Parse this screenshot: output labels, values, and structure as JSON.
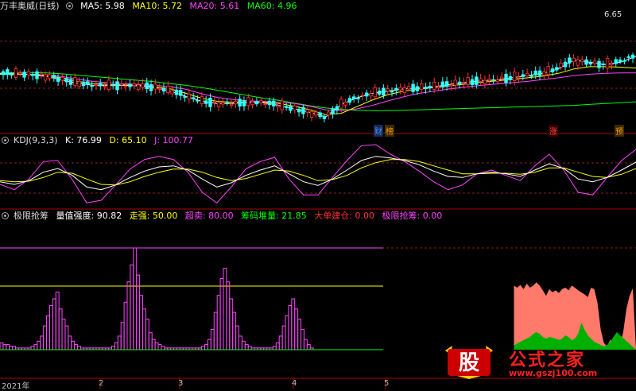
{
  "main": {
    "title": "万丰奥威(日线)",
    "ma": [
      {
        "label": "MA5: 5.98",
        "color": "#ffffff"
      },
      {
        "label": "MA10: 5.72",
        "color": "#ffff00"
      },
      {
        "label": "MA20: 5.61",
        "color": "#ff44ff"
      },
      {
        "label": "MA60: 4.96",
        "color": "#00ff00"
      }
    ],
    "high_label": "6.65",
    "markers": [
      {
        "text": "财",
        "color": "#4a90ff"
      },
      {
        "text": "榜",
        "color": "#ff9900"
      },
      {
        "text": "涨",
        "color": "#ff4444"
      },
      {
        "text": "预",
        "color": "#ff9900"
      }
    ]
  },
  "kdj": {
    "title": "KDJ(9,3,3)",
    "values": [
      {
        "label": "K: 76.99",
        "color": "#ffffff"
      },
      {
        "label": "D: 65.10",
        "color": "#ffff00"
      },
      {
        "label": "J: 100.77",
        "color": "#ff44ff"
      }
    ]
  },
  "ind": {
    "title": "极限抢筹",
    "values": [
      {
        "label": "量值强度: 90.82",
        "color": "#ffffff"
      },
      {
        "label": "走强: 50.00",
        "color": "#ffff00"
      },
      {
        "label": "超卖: 80.00",
        "color": "#ff44ff"
      },
      {
        "label": "筹码堆量: 21.85",
        "color": "#00ff00"
      },
      {
        "label": "大单建仓: 0.00",
        "color": "#ff3333"
      },
      {
        "label": "极限抢筹: 0.00",
        "color": "#ff44ff"
      }
    ]
  },
  "dates": [
    "2021年",
    "2",
    "3",
    "4",
    "5"
  ],
  "watermark": {
    "logo": "股",
    "name": "公式之家",
    "url": "www.gszj100.com"
  },
  "chart_data": [
    {
      "type": "candlestick",
      "panel": "main",
      "ylim": [
        4.3,
        7.0
      ],
      "ma": {
        "MA5": [
          5.6,
          5.6,
          5.57,
          5.53,
          5.45,
          5.38,
          5.33,
          5.33,
          5.33,
          5.32,
          5.28,
          5.2,
          5.08,
          4.97,
          4.92,
          4.92,
          4.95,
          4.94,
          4.88,
          4.8,
          4.72,
          4.62,
          4.9,
          5.05,
          5.15,
          5.2,
          5.25,
          5.27,
          5.3,
          5.35,
          5.4,
          5.43,
          5.45,
          5.5,
          5.55,
          5.6,
          5.7,
          5.9,
          5.85,
          5.8,
          5.85,
          5.98
        ],
        "MA10": [
          5.58,
          5.58,
          5.57,
          5.55,
          5.5,
          5.42,
          5.37,
          5.35,
          5.34,
          5.33,
          5.3,
          5.25,
          5.15,
          5.04,
          4.97,
          4.95,
          4.95,
          4.95,
          4.92,
          4.86,
          4.78,
          4.67,
          4.7,
          4.85,
          5.0,
          5.12,
          5.2,
          5.25,
          5.28,
          5.32,
          5.36,
          5.4,
          5.43,
          5.46,
          5.5,
          5.54,
          5.6,
          5.7,
          5.75,
          5.75,
          5.74,
          5.72
        ],
        "MA20": [
          5.58,
          5.58,
          5.58,
          5.57,
          5.53,
          5.47,
          5.42,
          5.39,
          5.37,
          5.35,
          5.33,
          5.3,
          5.24,
          5.14,
          5.06,
          5.01,
          4.98,
          4.97,
          4.95,
          4.92,
          4.86,
          4.78,
          4.76,
          4.8,
          4.88,
          4.98,
          5.07,
          5.15,
          5.2,
          5.25,
          5.29,
          5.33,
          5.36,
          5.39,
          5.42,
          5.46,
          5.5,
          5.55,
          5.58,
          5.6,
          5.61,
          5.61
        ],
        "MA60": [
          5.6,
          5.62,
          5.62,
          5.61,
          5.59,
          5.56,
          5.53,
          5.5,
          5.47,
          5.44,
          5.41,
          5.37,
          5.33,
          5.28,
          5.22,
          5.16,
          5.1,
          5.04,
          4.99,
          4.93,
          4.87,
          4.82,
          4.79,
          4.77,
          4.76,
          4.76,
          4.77,
          4.78,
          4.79,
          4.8,
          4.81,
          4.82,
          4.83,
          4.84,
          4.85,
          4.86,
          4.87,
          4.88,
          4.9,
          4.92,
          4.94,
          4.96
        ]
      },
      "series_colors": {
        "MA5": "#ffffff",
        "MA10": "#ffff00",
        "MA20": "#ff44ff",
        "MA60": "#00ff00"
      },
      "annotations": [
        "6.65"
      ]
    },
    {
      "type": "line",
      "panel": "kdj",
      "ylim": [
        -10,
        110
      ],
      "series": [
        {
          "name": "K",
          "color": "#ffffff",
          "values": [
            40,
            35,
            42,
            58,
            65,
            52,
            30,
            25,
            34,
            48,
            60,
            68,
            70,
            62,
            45,
            30,
            38,
            52,
            62,
            70,
            55,
            40,
            33,
            45,
            62,
            80,
            88,
            85,
            80,
            72,
            60,
            50,
            48,
            55,
            58,
            55,
            50,
            62,
            74,
            65,
            45,
            40,
            48,
            62,
            77
          ]
        },
        {
          "name": "D",
          "color": "#ffff00",
          "values": [
            42,
            40,
            41,
            48,
            58,
            56,
            45,
            35,
            34,
            40,
            50,
            58,
            64,
            64,
            58,
            48,
            42,
            46,
            54,
            62,
            60,
            52,
            42,
            44,
            52,
            66,
            76,
            82,
            82,
            78,
            70,
            62,
            55,
            55,
            56,
            56,
            54,
            58,
            66,
            66,
            58,
            50,
            48,
            54,
            65
          ]
        },
        {
          "name": "J",
          "color": "#ff44ff",
          "values": [
            35,
            25,
            45,
            78,
            80,
            44,
            0,
            5,
            34,
            64,
            82,
            88,
            82,
            58,
            20,
            0,
            30,
            64,
            78,
            86,
            45,
            15,
            15,
            48,
            80,
            108,
            110,
            92,
            78,
            60,
            40,
            25,
            34,
            55,
            62,
            52,
            42,
            70,
            92,
            62,
            20,
            15,
            48,
            80,
            101
          ]
        }
      ]
    },
    {
      "type": "bar",
      "panel": "indicator",
      "series": [
        {
          "name": "量值强度",
          "color": "#ff7a6a",
          "values": [
            0,
            0,
            0,
            0,
            0,
            0,
            0,
            0,
            0,
            0,
            0,
            0,
            0,
            0,
            0,
            0,
            0,
            0,
            0,
            0,
            0,
            0,
            0,
            0,
            0,
            0,
            0,
            0,
            0,
            0,
            0,
            0,
            0,
            0,
            0,
            0,
            0,
            0,
            0,
            0,
            0,
            0,
            0,
            0,
            0,
            0,
            0,
            0,
            0,
            0,
            0,
            0,
            0,
            0,
            0,
            0,
            0,
            0,
            0,
            0,
            0,
            0,
            0,
            0,
            0,
            0,
            0,
            0,
            0,
            0,
            0,
            0,
            0,
            0,
            0,
            0,
            0,
            0,
            0,
            0,
            0,
            0,
            0,
            0,
            0,
            0,
            0,
            0,
            0,
            0,
            0,
            0,
            0,
            0,
            0,
            0,
            0,
            0,
            0,
            0,
            0,
            0,
            0,
            0,
            0,
            0,
            0,
            0,
            0,
            0,
            0,
            0,
            0,
            0,
            0,
            0,
            0,
            0,
            0,
            0,
            0,
            0,
            0,
            0,
            0,
            0,
            0,
            0,
            0,
            0,
            0,
            0,
            0,
            0,
            0,
            0,
            0,
            0,
            0,
            0,
            0,
            0,
            0,
            0,
            0,
            0,
            0,
            0,
            0,
            0,
            0,
            0,
            0,
            0,
            0,
            0,
            0,
            0,
            0,
            0,
            95,
            92,
            96,
            90,
            98,
            92,
            95,
            100,
            95,
            88,
            80,
            90,
            85,
            88,
            84,
            90,
            92,
            88,
            95,
            92,
            88,
            85,
            82,
            78,
            92,
            90,
            70,
            30,
            10,
            5,
            15,
            5,
            0,
            8,
            25,
            60,
            80,
            91
          ]
        },
        {
          "name": "筹码堆量",
          "color": "#00cc00",
          "values": [
            0,
            0,
            0,
            0,
            0,
            0,
            0,
            0,
            0,
            0,
            0,
            0,
            0,
            0,
            0,
            0,
            0,
            0,
            0,
            0,
            0,
            0,
            0,
            0,
            0,
            0,
            0,
            0,
            0,
            0,
            0,
            0,
            0,
            0,
            0,
            0,
            0,
            0,
            0,
            0,
            0,
            0,
            0,
            0,
            0,
            0,
            0,
            0,
            0,
            0,
            0,
            0,
            0,
            0,
            0,
            0,
            0,
            0,
            0,
            0,
            0,
            0,
            0,
            0,
            0,
            0,
            0,
            0,
            0,
            0,
            0,
            0,
            0,
            0,
            0,
            0,
            0,
            0,
            0,
            0,
            0,
            0,
            0,
            0,
            0,
            0,
            0,
            0,
            0,
            0,
            0,
            0,
            0,
            0,
            0,
            0,
            0,
            0,
            0,
            0,
            0,
            0,
            0,
            0,
            0,
            0,
            0,
            0,
            0,
            0,
            0,
            0,
            0,
            0,
            0,
            0,
            0,
            0,
            0,
            0,
            0,
            0,
            0,
            0,
            0,
            0,
            0,
            0,
            0,
            0,
            0,
            0,
            0,
            0,
            0,
            0,
            0,
            0,
            0,
            0,
            0,
            0,
            0,
            0,
            0,
            0,
            0,
            0,
            0,
            0,
            0,
            0,
            0,
            0,
            0,
            0,
            0,
            0,
            0,
            0,
            5,
            8,
            10,
            12,
            14,
            16,
            20,
            22,
            20,
            16,
            14,
            16,
            15,
            14,
            12,
            14,
            18,
            16,
            12,
            14,
            20,
            34,
            25,
            18,
            14,
            10,
            8,
            6,
            4,
            6,
            10,
            16,
            22
          ]
        },
        {
          "name": "极限抢筹",
          "color": "#ff44ff",
          "values": [
            4,
            3,
            3,
            2,
            2,
            1,
            1,
            1,
            1,
            1,
            2,
            3,
            5,
            8,
            14,
            20,
            26,
            30,
            34,
            24,
            18,
            14,
            8,
            5,
            3,
            2,
            1,
            1,
            1,
            1,
            1,
            1,
            1,
            1,
            1,
            1,
            2,
            4,
            8,
            16,
            28,
            40,
            50,
            60,
            44,
            32,
            24,
            18,
            10,
            6,
            4,
            3,
            2,
            1,
            1,
            1,
            1,
            1,
            1,
            1,
            1,
            1,
            1,
            1,
            1,
            2,
            3,
            6,
            12,
            22,
            32,
            42,
            48,
            40,
            30,
            22,
            14,
            8,
            5,
            3,
            2,
            1,
            1,
            1,
            1,
            1,
            1,
            1,
            2,
            4,
            8,
            14,
            20,
            26,
            30,
            24,
            18,
            12,
            6,
            3,
            1,
            0,
            0,
            0,
            0,
            0,
            0,
            0,
            0,
            0,
            0,
            0,
            0,
            0,
            0,
            0,
            0,
            0,
            0,
            0,
            0,
            0,
            0,
            0,
            0,
            0,
            0,
            0,
            0,
            0,
            0,
            0,
            0,
            0,
            0,
            0,
            0,
            0,
            0,
            0,
            0,
            0,
            0,
            0,
            0,
            0,
            0,
            0,
            0,
            0,
            0,
            0,
            0,
            0,
            0,
            0,
            0,
            0,
            0,
            0,
            0,
            0,
            0,
            0,
            0,
            0,
            0,
            0,
            0,
            0,
            0,
            0,
            0,
            0,
            0,
            0,
            0,
            0,
            0,
            0,
            0,
            0,
            0,
            0,
            0,
            0,
            0,
            0,
            0,
            0,
            0,
            0,
            0,
            0,
            0,
            0,
            0,
            0,
            0,
            0,
            0,
            0,
            0,
            0,
            0
          ]
        }
      ],
      "levels": [
        {
          "name": "走强",
          "value": 50,
          "color": "#ffff00"
        },
        {
          "name": "超卖",
          "value": 80,
          "color": "#ff44ff"
        }
      ]
    }
  ]
}
